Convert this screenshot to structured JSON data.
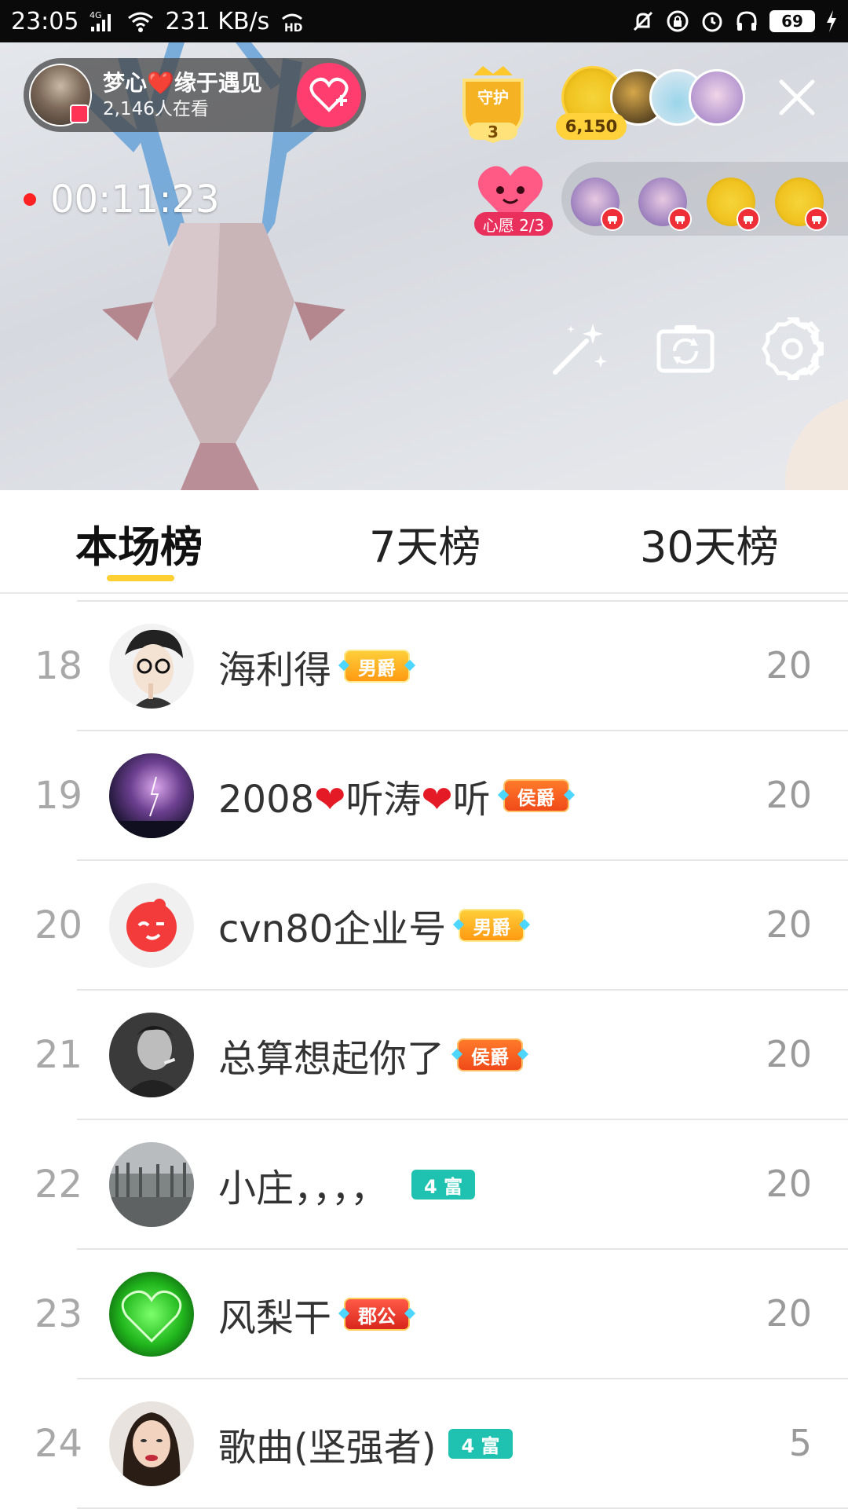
{
  "status_bar": {
    "time": "23:05",
    "network": "4G",
    "speed": "231 KB/s",
    "battery": "69"
  },
  "host": {
    "name": "梦心❤️缘于遇见",
    "viewers": "2,146人在看"
  },
  "guard": {
    "label": "守护",
    "count": "3"
  },
  "gold_count": "6,150",
  "timer": "00:11:23",
  "wish": {
    "label": "心愿 2/3"
  },
  "tabs": [
    {
      "label": "本场榜",
      "active": true
    },
    {
      "label": "7天榜",
      "active": false
    },
    {
      "label": "30天榜",
      "active": false
    }
  ],
  "ranking": [
    {
      "rank": "18",
      "name": "海利得",
      "badge": "男爵",
      "badge_type": "noble-m",
      "score": "20",
      "avatar": "glasses-man"
    },
    {
      "rank": "19",
      "name_parts": [
        "2008",
        "❤",
        "听涛",
        "❤",
        "听"
      ],
      "badge": "侯爵",
      "badge_type": "noble-h",
      "score": "20",
      "avatar": "storm-sky"
    },
    {
      "rank": "20",
      "name": "cvn80企业号",
      "badge": "男爵",
      "badge_type": "noble-m",
      "score": "20",
      "avatar": "red-wink-logo"
    },
    {
      "rank": "21",
      "name": "总算想起你了",
      "badge": "侯爵",
      "badge_type": "noble-h",
      "score": "20",
      "avatar": "bw-portrait"
    },
    {
      "rank": "22",
      "name": "小庄，，，，",
      "badge": "4 富",
      "badge_type": "rich",
      "score": "20",
      "avatar": "foggy-trees"
    },
    {
      "rank": "23",
      "name": "风梨干",
      "badge": "郡公",
      "badge_type": "noble-d",
      "score": "20",
      "avatar": "green-heart"
    },
    {
      "rank": "24",
      "name": "歌曲(坚强者)",
      "badge": "4 富",
      "badge_type": "rich",
      "score": "5",
      "avatar": "woman-portrait"
    }
  ],
  "colors": {
    "accent_yellow": "#ffcf33",
    "heart_red": "#e41b26",
    "follow_pink": "#ff3d6e",
    "rich_teal": "#1fc2b0"
  }
}
